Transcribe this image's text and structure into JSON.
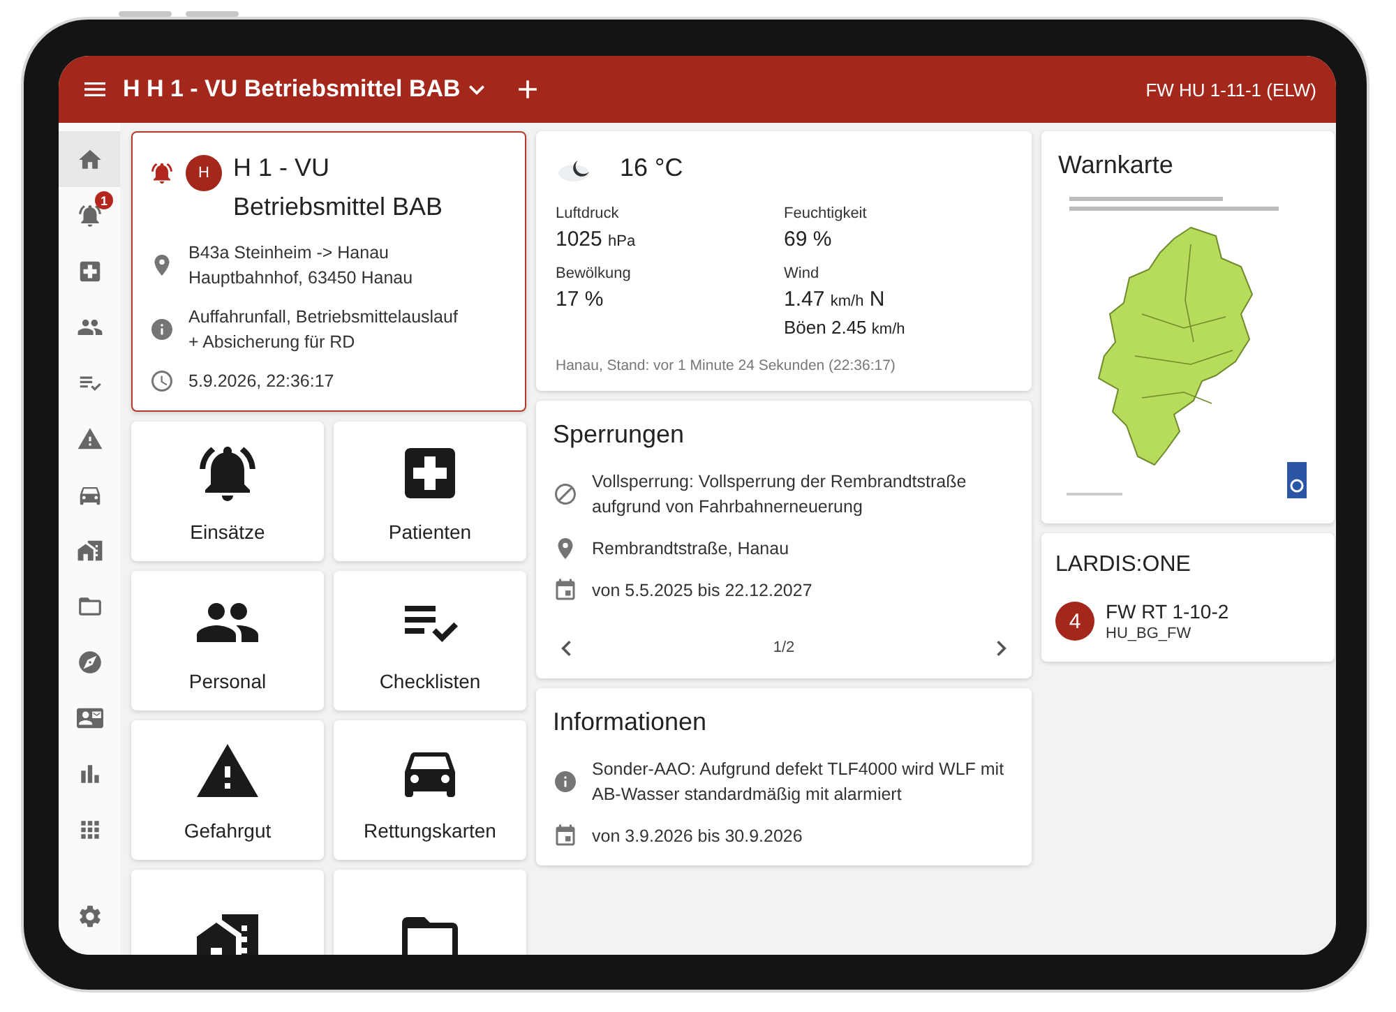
{
  "header": {
    "title": "H H 1 - VU Betriebsmittel BAB",
    "unit": "FW HU 1-11-1 (ELW)"
  },
  "sidebar": {
    "items": [
      {
        "kind": "home",
        "selected": true
      },
      {
        "kind": "alarm",
        "selected": false,
        "badge": "1"
      },
      {
        "kind": "hospital",
        "selected": false
      },
      {
        "kind": "people",
        "selected": false
      },
      {
        "kind": "checklist",
        "selected": false
      },
      {
        "kind": "warning",
        "selected": false
      },
      {
        "kind": "car",
        "selected": false
      },
      {
        "kind": "house",
        "selected": false
      },
      {
        "kind": "folder",
        "selected": false
      },
      {
        "kind": "compass",
        "selected": false
      },
      {
        "kind": "contact",
        "selected": false
      },
      {
        "kind": "chart",
        "selected": false
      },
      {
        "kind": "apps",
        "selected": false
      }
    ],
    "bottom_item": {
      "kind": "settings",
      "selected": false
    }
  },
  "incident": {
    "avatar": "H",
    "title": "H 1 - VU Betriebsmittel BAB",
    "details": [
      {
        "kind": "place",
        "text": "B43a Steinheim -> Hanau Hauptbahnhof, 63450 Hanau"
      },
      {
        "kind": "info",
        "text": "Auffahrunfall, Betriebsmittelauslauf + Absicherung für RD"
      },
      {
        "kind": "time",
        "text": "5.9.2026, 22:36:17"
      }
    ]
  },
  "tiles": [
    {
      "kind": "alarm",
      "label": "Einsätze"
    },
    {
      "kind": "hospital",
      "label": "Patienten"
    },
    {
      "kind": "people",
      "label": "Personal"
    },
    {
      "kind": "checklist",
      "label": "Checklisten"
    },
    {
      "kind": "warning",
      "label": "Gefahrgut"
    },
    {
      "kind": "car",
      "label": "Rettungskarten"
    },
    {
      "kind": "house"
    },
    {
      "kind": "folder"
    }
  ],
  "weather": {
    "temperature": "16 °C",
    "metrics": [
      {
        "label": "Luftdruck",
        "value": "1025",
        "unit": "hPa"
      },
      {
        "label": "Feuchtigkeit",
        "value": "69 %"
      },
      {
        "label": "Bewölkung",
        "value": "17 %"
      },
      {
        "label": "Wind",
        "value": "1.47",
        "unit": "km/h",
        "suffix": "N",
        "extra": "Böen 2.45",
        "extra_unit": "km/h"
      }
    ],
    "footer": "Hanau, Stand: vor 1 Minute 24 Sekunden (22:36:17)"
  },
  "closures": {
    "title": "Sperrungen",
    "details": [
      {
        "kind": "blocked",
        "text": "Vollsperrung: Vollsperrung der Rembrandtstraße aufgrund von Fahrbahnerneuerung"
      },
      {
        "kind": "place",
        "text": "Rembrandtstraße, Hanau"
      },
      {
        "kind": "date",
        "text": "von 5.5.2025 bis 22.12.2027"
      }
    ],
    "page": "1/2"
  },
  "information": {
    "title": "Informationen",
    "details": [
      {
        "kind": "info",
        "text": "Sonder-AAO: Aufgrund defekt TLF4000 wird WLF mit AB-Wasser standardmäßig mit alarmiert"
      },
      {
        "kind": "date",
        "text": "von 3.9.2026 bis 30.9.2026"
      }
    ]
  },
  "warning_map": {
    "title": "Warnkarte"
  },
  "lardis": {
    "title": "LARDIS:ONE",
    "entries": [
      {
        "status": "4",
        "name": "FW RT 1-10-2",
        "group": "HU_BG_FW"
      }
    ]
  }
}
